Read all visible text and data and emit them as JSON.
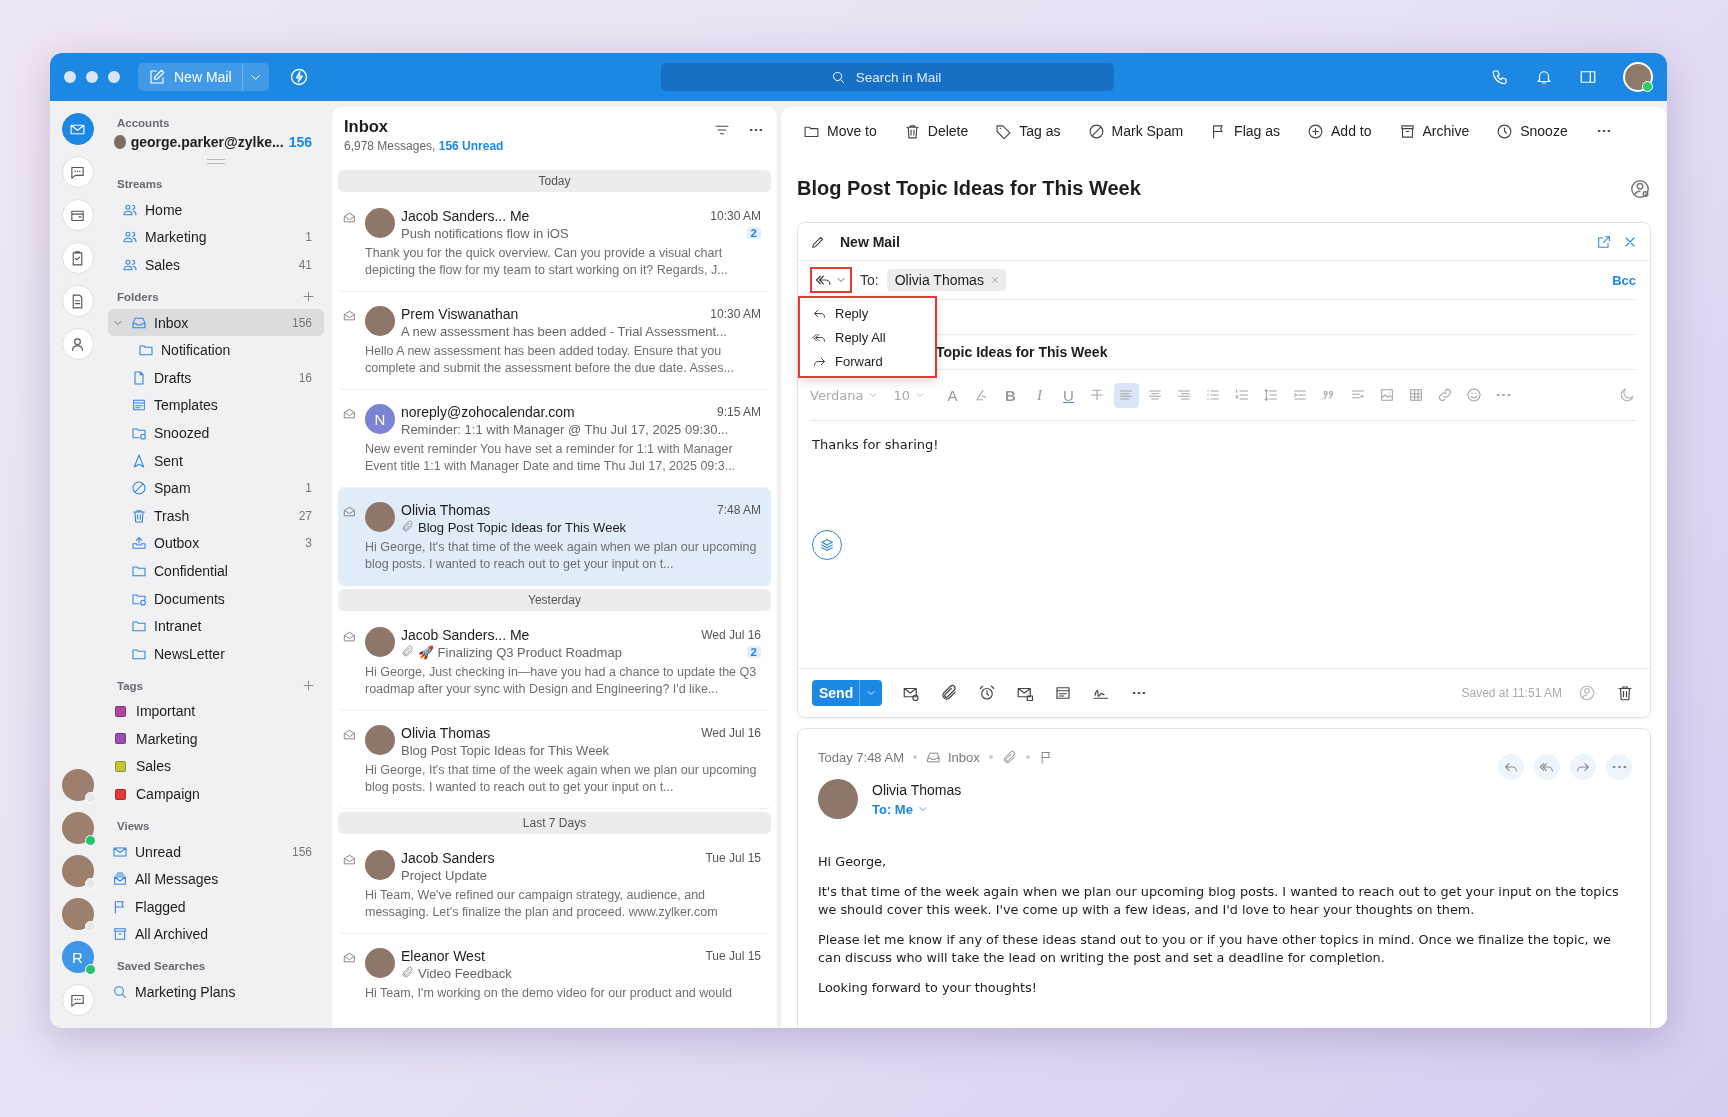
{
  "topbar": {
    "new_mail": "New Mail",
    "search_placeholder": "Search in Mail"
  },
  "rail": {
    "apps": [
      {
        "kind": "mail",
        "selected": true
      },
      {
        "kind": "chat",
        "selected": false
      },
      {
        "kind": "calendar",
        "selected": false
      },
      {
        "kind": "tasks",
        "selected": false
      },
      {
        "kind": "notes",
        "selected": false
      },
      {
        "kind": "contacts",
        "selected": false
      }
    ],
    "contacts": [
      {
        "kind": "photo",
        "online": false
      },
      {
        "kind": "photo",
        "online": true
      },
      {
        "kind": "photo",
        "online": false
      },
      {
        "kind": "photo",
        "online": false
      },
      {
        "kind": "letter",
        "initial": "R",
        "online": true
      }
    ]
  },
  "sidebar": {
    "accounts_label": "Accounts",
    "account": {
      "email": "george.parker@zylke...",
      "count": "156"
    },
    "sections": [
      {
        "title": "Streams",
        "addable": false,
        "items": [
          {
            "kind": "stream",
            "label": "Home",
            "selected": false
          },
          {
            "kind": "stream",
            "label": "Marketing",
            "count": "1",
            "selected": false
          },
          {
            "kind": "stream",
            "label": "Sales",
            "count": "41",
            "selected": false
          }
        ]
      },
      {
        "title": "Folders",
        "addable": true,
        "items": [
          {
            "kind": "inbox",
            "label": "Inbox",
            "count": "156",
            "selected": true,
            "expanded": true,
            "children": [
              {
                "kind": "folder",
                "label": "Notification",
                "selected": false
              }
            ]
          },
          {
            "kind": "drafts",
            "label": "Drafts",
            "count": "16",
            "selected": false
          },
          {
            "kind": "templates",
            "label": "Templates",
            "selected": false
          },
          {
            "kind": "snoozed",
            "label": "Snoozed",
            "selected": false
          },
          {
            "kind": "sent",
            "label": "Sent",
            "selected": false
          },
          {
            "kind": "spam",
            "label": "Spam",
            "count": "1",
            "selected": false
          },
          {
            "kind": "trash",
            "label": "Trash",
            "count": "27",
            "selected": false
          },
          {
            "kind": "outbox",
            "label": "Outbox",
            "count": "3",
            "selected": false
          },
          {
            "kind": "folder",
            "label": "Confidential",
            "selected": false
          },
          {
            "kind": "shared",
            "label": "Documents",
            "selected": false
          },
          {
            "kind": "folder",
            "label": "Intranet",
            "selected": false
          },
          {
            "kind": "folder",
            "label": "NewsLetter",
            "selected": false
          }
        ]
      },
      {
        "title": "Tags",
        "addable": true,
        "items": [
          {
            "kind": "tag",
            "label": "Important",
            "color": "#b0479e",
            "selected": false
          },
          {
            "kind": "tag",
            "label": "Marketing",
            "color": "#9b4fb5",
            "selected": false
          },
          {
            "kind": "tag",
            "label": "Sales",
            "color": "#c2c43a",
            "selected": false
          },
          {
            "kind": "tag",
            "label": "Campaign",
            "color": "#e53935",
            "selected": false
          }
        ]
      },
      {
        "title": "Views",
        "addable": false,
        "items": [
          {
            "kind": "unread",
            "label": "Unread",
            "count": "156",
            "selected": false
          },
          {
            "kind": "all",
            "label": "All Messages",
            "selected": false
          },
          {
            "kind": "flagged",
            "label": "Flagged",
            "selected": false
          },
          {
            "kind": "archived",
            "label": "All Archived",
            "selected": false
          }
        ]
      },
      {
        "title": "Saved Searches",
        "addable": false,
        "items": [
          {
            "kind": "search",
            "label": "Marketing Plans",
            "selected": false
          }
        ]
      }
    ]
  },
  "list": {
    "title": "Inbox",
    "total": "6,978 Messages,",
    "unread": "156 Unread",
    "groups": [
      {
        "label": "Today",
        "mails": [
          {
            "sender": "Jacob Sanders... Me",
            "time": "10:30 AM",
            "subject": "Push notifications flow in iOS",
            "preview": "Thank you for the quick overview. Can you provide a visual chart depicting the flow for my team to start working on it? Regards, J...",
            "avatar": {
              "kind": "photo"
            },
            "count": "2",
            "attachment": false,
            "selected": false
          },
          {
            "sender": "Prem Viswanathan",
            "time": "10:30 AM",
            "subject": "A new assessment has been added - Trial Assessment...",
            "preview": "Hello A new assessment has been added today. Ensure that you complete and submit the assessment before the due date. Asses...",
            "avatar": {
              "kind": "photo"
            },
            "attachment": false,
            "selected": false
          },
          {
            "sender": "noreply@zohocalendar.com",
            "time": "9:15 AM",
            "subject": "Reminder: 1:1 with Manager @ Thu Jul 17, 2025 09:30...",
            "preview": "New event reminder You have set a reminder for 1:1 with Manager Event title 1:1 with Manager Date and time Thu Jul 17, 2025 09:3...",
            "avatar": {
              "kind": "letter",
              "initial": "N"
            },
            "attachment": false,
            "selected": false
          },
          {
            "sender": "Olivia Thomas",
            "time": "7:48 AM",
            "subject": "Blog Post Topic Ideas for This Week",
            "preview": "Hi George, It's that time of the week again when we plan our upcoming blog posts. I wanted to reach out to get your input on t...",
            "avatar": {
              "kind": "photo"
            },
            "attachment": true,
            "selected": true
          }
        ]
      },
      {
        "label": "Yesterday",
        "mails": [
          {
            "sender": "Jacob Sanders... Me",
            "time": "Wed Jul 16",
            "subject": "🚀 Finalizing Q3 Product Roadmap",
            "preview": "Hi George, Just checking in—have you had a chance to update the Q3 roadmap after your sync with Design and Engineering? I'd like...",
            "avatar": {
              "kind": "photo"
            },
            "count": "2",
            "attachment": true,
            "selected": false
          },
          {
            "sender": "Olivia Thomas",
            "time": "Wed Jul 16",
            "subject": "Blog Post Topic Ideas for This Week",
            "preview": "Hi George, It's that time of the week again when we plan our upcoming blog posts. I wanted to reach out to get your input on t...",
            "avatar": {
              "kind": "photo"
            },
            "attachment": false,
            "selected": false
          }
        ]
      },
      {
        "label": "Last 7 Days",
        "mails": [
          {
            "sender": "Jacob Sanders",
            "time": "Tue Jul 15",
            "subject": "Project Update",
            "preview": "Hi Team, We've refined our campaign strategy, audience, and messaging. Let's finalize the plan and proceed. www.zylker.com",
            "avatar": {
              "kind": "photo"
            },
            "attachment": false,
            "selected": false
          },
          {
            "sender": "Eleanor West",
            "time": "Tue Jul 15",
            "subject": "Video Feedback",
            "preview": "Hi Team, I'm working on the demo video for our product and would",
            "avatar": {
              "kind": "photo"
            },
            "attachment": true,
            "selected": false
          }
        ]
      }
    ]
  },
  "actions": [
    {
      "kind": "move",
      "label": "Move to"
    },
    {
      "kind": "delete",
      "label": "Delete"
    },
    {
      "kind": "tag",
      "label": "Tag as"
    },
    {
      "kind": "spam",
      "label": "Mark Spam"
    },
    {
      "kind": "flag",
      "label": "Flag as"
    },
    {
      "kind": "add",
      "label": "Add to"
    },
    {
      "kind": "archive",
      "label": "Archive"
    },
    {
      "kind": "snooze",
      "label": "Snooze"
    }
  ],
  "title": "Blog Post Topic Ideas for This Week",
  "compose": {
    "title": "New Mail",
    "reply_button": {
      "highlighted": true
    },
    "to_label": "To:",
    "recipients": [
      "Olivia Thomas"
    ],
    "bcc": "Bcc",
    "reply_menu": {
      "highlighted": true,
      "items": [
        {
          "kind": "reply",
          "label": "Reply"
        },
        {
          "kind": "replyall",
          "label": "Reply All"
        },
        {
          "kind": "forward",
          "label": "Forward"
        }
      ]
    },
    "subject": "Topic Ideas for This Week",
    "font": "Verdana",
    "font_size": "10",
    "format_tools": [
      {
        "kind": "text-color",
        "label": "A",
        "selected": false
      },
      {
        "kind": "clear",
        "selected": false
      },
      {
        "kind": "bold",
        "label": "B",
        "selected": false
      },
      {
        "kind": "italic",
        "label": "I",
        "selected": false
      },
      {
        "kind": "underline",
        "label": "U",
        "selected": false
      },
      {
        "kind": "strike",
        "selected": false
      },
      {
        "kind": "align-left",
        "selected": true
      },
      {
        "kind": "align-center",
        "selected": false
      },
      {
        "kind": "align-right",
        "selected": false
      },
      {
        "kind": "bullets",
        "selected": false
      },
      {
        "kind": "numbers",
        "selected": false
      },
      {
        "kind": "line-height",
        "selected": false
      },
      {
        "kind": "indent",
        "selected": false
      },
      {
        "kind": "quote",
        "selected": false
      },
      {
        "kind": "checklist",
        "selected": false
      },
      {
        "kind": "image",
        "selected": false
      },
      {
        "kind": "table",
        "selected": false
      },
      {
        "kind": "link",
        "selected": false
      },
      {
        "kind": "emoji",
        "selected": false
      },
      {
        "kind": "more",
        "selected": false
      }
    ],
    "body": "Thanks for sharing!",
    "send": "Send",
    "saved": "Saved at 11:51 AM"
  },
  "message": {
    "date": "Today 7:48 AM",
    "folder": "Inbox",
    "sender": "Olivia Thomas",
    "to": "To: Me",
    "paragraphs": [
      "Hi George,",
      "It's that time of the week again when we plan our upcoming blog posts. I wanted to reach out to get your input on the topics we should cover this week. I've come up with a few ideas, and I'd love to hear your thoughts on them.",
      "Please let me know if any of these ideas stand out to you or if you have other topics in mind. Once we finalize the topic, we can discuss who will take the lead on writing the post and set a deadline for completion.",
      "Looking forward to your thoughts!"
    ]
  }
}
